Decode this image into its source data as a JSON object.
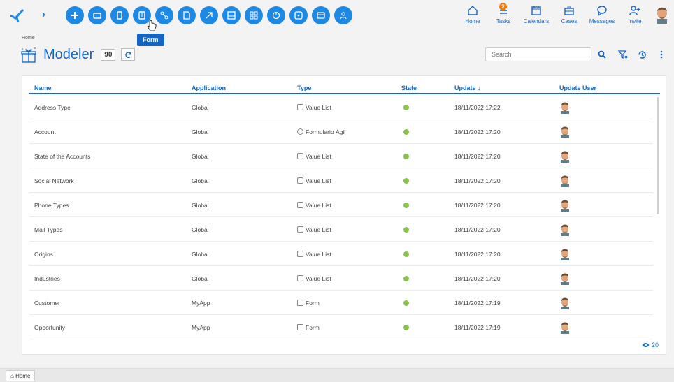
{
  "toolbar": {
    "tooltip": "Form",
    "icons": [
      "add-icon",
      "folder-icon",
      "mobile-icon",
      "form-icon",
      "workflow-icon",
      "document-icon",
      "agile-form-icon",
      "page-icon",
      "dashboard-icon",
      "report-icon",
      "value-list-icon",
      "entity-icon",
      "user-icon"
    ]
  },
  "nav": {
    "home": "Home",
    "tasks": "Tasks",
    "tasks_badge": "9",
    "calendars": "Calendars",
    "cases": "Cases",
    "messages": "Messages",
    "invite": "Invite"
  },
  "page": {
    "breadcrumb": "Home",
    "title": "Modeler",
    "count": "90",
    "search_placeholder": "Search"
  },
  "table": {
    "headers": {
      "name": "Name",
      "application": "Application",
      "type": "Type",
      "state": "State",
      "update": "Update ↓",
      "update_user": "Update User"
    },
    "rows": [
      {
        "name": "Address Type",
        "application": "Global",
        "type": "Value List",
        "update": "18/11/2022 17:22"
      },
      {
        "name": "Account",
        "application": "Global",
        "type": "Formulario Ágil",
        "update": "18/11/2022 17:20"
      },
      {
        "name": "State of the Accounts",
        "application": "Global",
        "type": "Value List",
        "update": "18/11/2022 17:20"
      },
      {
        "name": "Social Network",
        "application": "Global",
        "type": "Value List",
        "update": "18/11/2022 17:20"
      },
      {
        "name": "Phone Types",
        "application": "Global",
        "type": "Value List",
        "update": "18/11/2022 17:20"
      },
      {
        "name": "Mail Types",
        "application": "Global",
        "type": "Value List",
        "update": "18/11/2022 17:20"
      },
      {
        "name": "Origins",
        "application": "Global",
        "type": "Value List",
        "update": "18/11/2022 17:20"
      },
      {
        "name": "Industries",
        "application": "Global",
        "type": "Value List",
        "update": "18/11/2022 17:20"
      },
      {
        "name": "Customer",
        "application": "MyApp",
        "type": "Form",
        "update": "18/11/2022 17:19"
      },
      {
        "name": "Opportunity",
        "application": "MyApp",
        "type": "Form",
        "update": "18/11/2022 17:19"
      }
    ],
    "page_size": "20"
  },
  "colors": {
    "accent": "#1565c0",
    "button": "#1e88e5",
    "state_active": "#8bc34a"
  },
  "bottom": {
    "home_tab": "Home"
  }
}
